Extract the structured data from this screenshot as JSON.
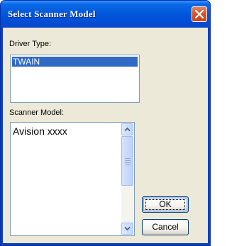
{
  "window": {
    "title": "Select Scanner Model"
  },
  "driver_type": {
    "label": "Driver Type:",
    "items": [
      "TWAIN"
    ],
    "selected": "TWAIN"
  },
  "scanner_model": {
    "label": "Scanner Model:",
    "items": [
      "Avision xxxx"
    ]
  },
  "buttons": {
    "ok": "OK",
    "cancel": "Cancel"
  },
  "colors": {
    "titlebar": "#0054e3",
    "selection": "#316ac5",
    "dialog_bg": "#ece9d8",
    "close_button": "#d8552c"
  },
  "icons": {
    "close": "close-icon",
    "scroll_up": "chevron-up-icon",
    "scroll_down": "chevron-down-icon"
  }
}
